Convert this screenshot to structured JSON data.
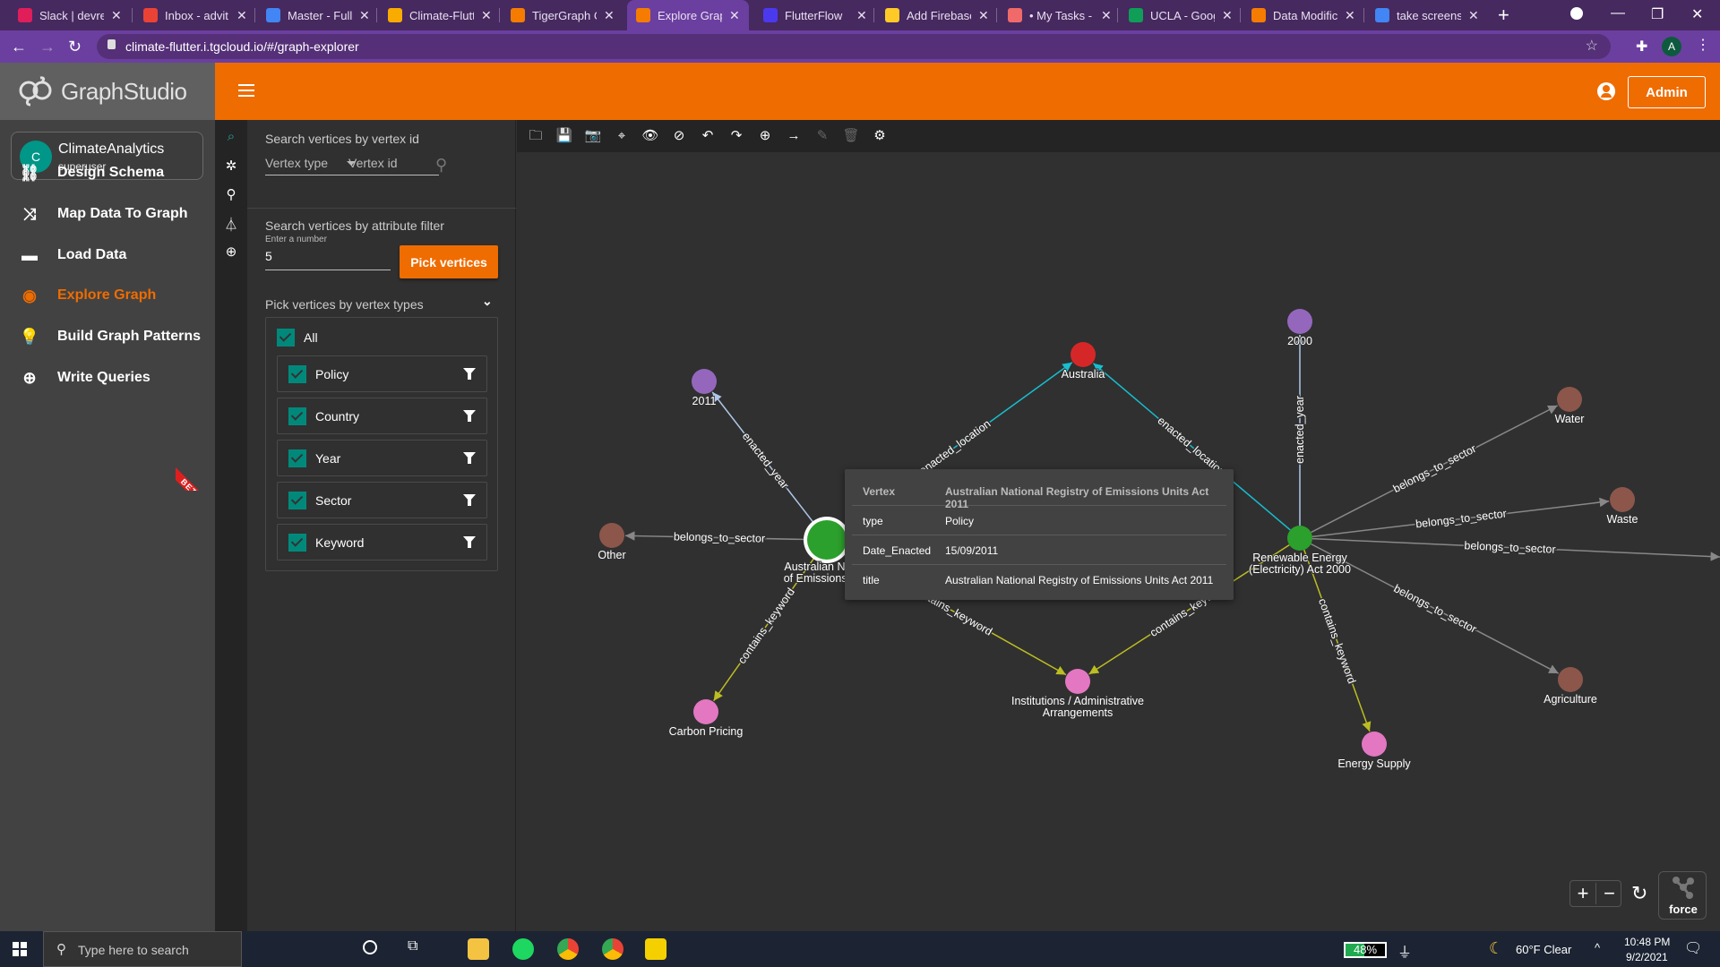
{
  "browser": {
    "tabs": [
      {
        "title": "Slack | devrel",
        "icon": "slack-icon",
        "color": "#e01e5a",
        "active": false
      },
      {
        "title": "Inbox - advit.c",
        "icon": "gmail-icon",
        "color": "#ea4335",
        "active": false
      },
      {
        "title": "Master - Fulls",
        "icon": "docs-icon",
        "color": "#4285f4",
        "active": false
      },
      {
        "title": "Climate-Flutte",
        "icon": "colab-icon",
        "color": "#f9ab00",
        "active": false
      },
      {
        "title": "TigerGraph Cl",
        "icon": "tigergraph-icon",
        "color": "#f57c00",
        "active": false
      },
      {
        "title": "Explore Graph",
        "icon": "graphstudio-icon",
        "color": "#f57c00",
        "active": true
      },
      {
        "title": "FlutterFlow",
        "icon": "flutterflow-icon",
        "color": "#4b39ef",
        "active": false
      },
      {
        "title": "Add Firebase",
        "icon": "firebase-icon",
        "color": "#ffca28",
        "active": false
      },
      {
        "title": "• My Tasks - A",
        "icon": "asana-icon",
        "color": "#f06a6a",
        "active": false
      },
      {
        "title": "UCLA - Googl",
        "icon": "drive-icon",
        "color": "#0f9d58",
        "active": false
      },
      {
        "title": "Data Modifica",
        "icon": "tigergraph-docs-icon",
        "color": "#f57c00",
        "active": false
      },
      {
        "title": "take screensh",
        "icon": "google-icon",
        "color": "#4285f4",
        "active": false
      }
    ],
    "url": "climate-flutter.i.tgcloud.io/#/graph-explorer",
    "profile_initial": "A"
  },
  "app": {
    "logo_text_bold": "Graph",
    "logo_text": "Studio",
    "user": {
      "initial": "C",
      "name": "ClimateAnalytics",
      "role": "superuser"
    },
    "nav": [
      {
        "label": "Design Schema",
        "icon": "schema-icon",
        "glyph": "⛓",
        "active": false
      },
      {
        "label": "Map Data To Graph",
        "icon": "shuffle-icon",
        "glyph": "⤨",
        "active": false
      },
      {
        "label": "Load Data",
        "icon": "load-bar-icon",
        "glyph": "▬",
        "active": false
      },
      {
        "label": "Explore Graph",
        "icon": "compass-icon",
        "glyph": "◉",
        "active": true
      },
      {
        "label": "Build Graph Patterns",
        "icon": "lightbulb-icon",
        "glyph": "💡",
        "active": false,
        "badge": "BETA"
      },
      {
        "label": "Write Queries",
        "icon": "gsql-icon",
        "glyph": "⊕",
        "active": false
      }
    ],
    "header": {
      "admin_label": "Admin"
    },
    "accent": "#ef6c00",
    "teal": "#00897b"
  },
  "panel": {
    "search_title": "Search vertices by vertex id",
    "vertex_type_placeholder": "Vertex type",
    "vertex_id_placeholder": "Vertex id",
    "attr_title": "Search vertices by attribute filter",
    "number_label": "Enter a number",
    "number_value": "5",
    "pick_button": "Pick vertices",
    "types_title": "Pick vertices by vertex types",
    "all_label": "All",
    "types": [
      {
        "label": "Policy",
        "checked": true
      },
      {
        "label": "Country",
        "checked": true
      },
      {
        "label": "Year",
        "checked": true
      },
      {
        "label": "Sector",
        "checked": true
      },
      {
        "label": "Keyword",
        "checked": true
      }
    ]
  },
  "toolbar": [
    {
      "name": "open-icon",
      "glyph": "🗀",
      "enabled": true
    },
    {
      "name": "save-icon",
      "glyph": "💾",
      "enabled": true
    },
    {
      "name": "screenshot-icon",
      "glyph": "📷",
      "enabled": true
    },
    {
      "name": "locate-icon",
      "glyph": "⌖",
      "enabled": true
    },
    {
      "name": "show-icon",
      "glyph": "👁",
      "enabled": true
    },
    {
      "name": "hide-icon",
      "glyph": "⊘",
      "enabled": true
    },
    {
      "name": "undo-icon",
      "glyph": "↶",
      "enabled": true
    },
    {
      "name": "redo-icon",
      "glyph": "↷",
      "enabled": true
    },
    {
      "name": "add-vertex-icon",
      "glyph": "⊕",
      "enabled": true
    },
    {
      "name": "add-edge-icon",
      "glyph": "→",
      "enabled": true
    },
    {
      "name": "edit-icon",
      "glyph": "✎",
      "enabled": false
    },
    {
      "name": "delete-icon",
      "glyph": "🗑",
      "enabled": false
    },
    {
      "name": "settings-icon",
      "glyph": "⚙",
      "enabled": true
    }
  ],
  "graph": {
    "vertex_colors": {
      "Policy": "#2ca02c",
      "Country": "#d62728",
      "Year": "#9467bd",
      "Sector": "#8c564b",
      "Keyword": "#e377c2"
    },
    "edge_colors": {
      "enacted_year": "#aec7e8",
      "enacted_location": "#17becf",
      "belongs_to_sector": "#888888",
      "contains_keyword": "#bcbd22"
    },
    "vertices": [
      {
        "id": "policy1",
        "type": "Policy",
        "label": [
          "Australian Nation",
          "of Emissions Unit"
        ],
        "selected": true
      },
      {
        "id": "policy2",
        "type": "Policy",
        "label": [
          "Renewable Energy",
          "(Electricity) Act 2000"
        ]
      },
      {
        "id": "australia",
        "type": "Country",
        "label": [
          "Australia"
        ]
      },
      {
        "id": "y2011",
        "type": "Year",
        "label": [
          "2011"
        ]
      },
      {
        "id": "y2000",
        "type": "Year",
        "label": [
          "2000"
        ]
      },
      {
        "id": "other",
        "type": "Sector",
        "label": [
          "Other"
        ]
      },
      {
        "id": "water",
        "type": "Sector",
        "label": [
          "Water"
        ]
      },
      {
        "id": "waste",
        "type": "Sector",
        "label": [
          "Waste"
        ]
      },
      {
        "id": "agriculture",
        "type": "Sector",
        "label": [
          "Agriculture"
        ]
      },
      {
        "id": "carbon",
        "type": "Keyword",
        "label": [
          "Carbon Pricing"
        ]
      },
      {
        "id": "inst",
        "type": "Keyword",
        "label": [
          "Institutions / Administrative",
          "Arrangements"
        ]
      },
      {
        "id": "energy",
        "type": "Keyword",
        "label": [
          "Energy Supply"
        ]
      }
    ],
    "edges": [
      {
        "from": "policy1",
        "to": "y2011",
        "type": "enacted_year"
      },
      {
        "from": "policy1",
        "to": "australia",
        "type": "enacted_location"
      },
      {
        "from": "policy1",
        "to": "other",
        "type": "belongs_to_sector"
      },
      {
        "from": "policy1",
        "to": "carbon",
        "type": "contains_keyword"
      },
      {
        "from": "policy1",
        "to": "inst",
        "type": "contains_keyword"
      },
      {
        "from": "policy2",
        "to": "australia",
        "type": "enacted_location"
      },
      {
        "from": "policy2",
        "to": "y2000",
        "type": "enacted_year"
      },
      {
        "from": "policy2",
        "to": "water",
        "type": "belongs_to_sector"
      },
      {
        "from": "policy2",
        "to": "waste",
        "type": "belongs_to_sector"
      },
      {
        "from": "policy2",
        "to": "offscreen",
        "type": "belongs_to_sector"
      },
      {
        "from": "policy2",
        "to": "agriculture",
        "type": "belongs_to_sector"
      },
      {
        "from": "policy2",
        "to": "inst",
        "type": "contains_keyword"
      },
      {
        "from": "policy2",
        "to": "energy",
        "type": "contains_keyword"
      }
    ]
  },
  "tooltip": {
    "rows": [
      {
        "key": "Vertex",
        "value": "Australian National Registry of Emissions Units Act 2011"
      },
      {
        "key": "type",
        "value": "Policy"
      },
      {
        "key": "Date_Enacted",
        "value": "15/09/2011"
      },
      {
        "key": "title",
        "value": "Australian National Registry of Emissions Units Act 2011"
      }
    ]
  },
  "controls": {
    "zoom_in": "+",
    "zoom_out": "−",
    "layout_label": "force"
  },
  "taskbar": {
    "search_placeholder": "Type here to search",
    "battery": "48%",
    "battery_fraction": 0.48,
    "weather": "60°F  Clear",
    "time": "10:48 PM",
    "date": "9/2/2021"
  }
}
